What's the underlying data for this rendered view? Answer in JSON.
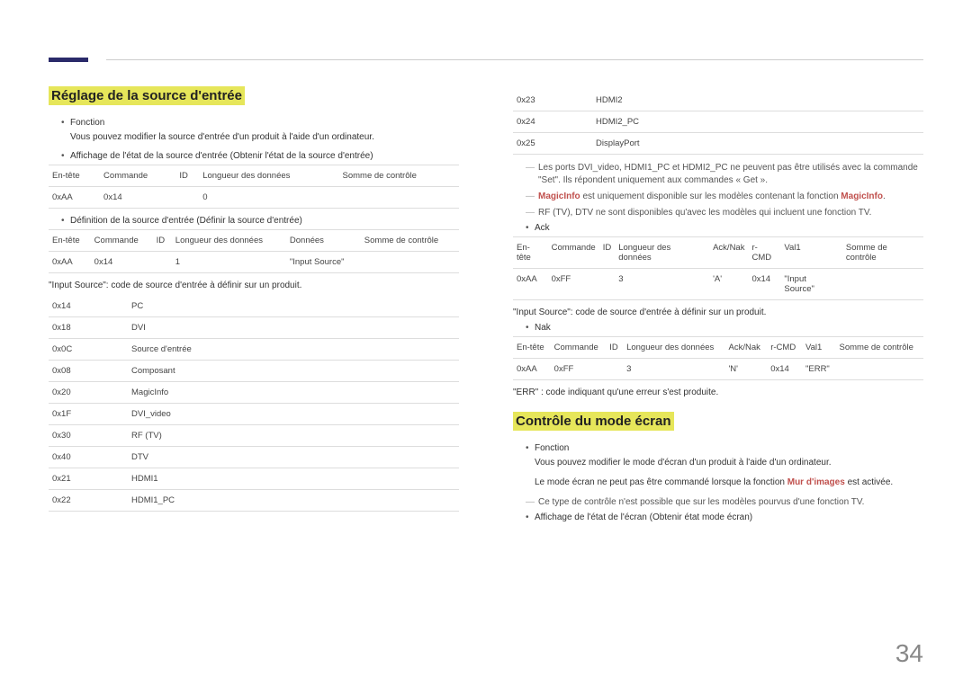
{
  "left": {
    "heading": "Réglage de la source d'entrée",
    "fn_label": "Fonction",
    "fn_text": "Vous pouvez modifier la source d'entrée d'un produit à l'aide d'un ordinateur.",
    "view_label": "Affichage de l'état de la source d'entrée (Obtenir l'état de la source d'entrée)",
    "t1": {
      "h0": "En-tête",
      "h1": "Commande",
      "h2": "ID",
      "h3": "Longueur des données",
      "h4": "Somme de contrôle",
      "r0": "0xAA",
      "r1": "0x14",
      "r2": "",
      "r3": "0",
      "r4": ""
    },
    "set_label": "Définition de la source d'entrée (Définir la source d'entrée)",
    "t2": {
      "h0": "En-tête",
      "h1": "Commande",
      "h2": "ID",
      "h3": "Longueur des données",
      "h4": "Données",
      "h5": "Somme de contrôle",
      "r0": "0xAA",
      "r1": "0x14",
      "r2": "",
      "r3": "1",
      "r4": "\"Input Source\"",
      "r5": ""
    },
    "is_desc": "\"Input Source\": code de source d'entrée à définir sur un produit.",
    "codes": [
      {
        "c": "0x14",
        "l": "PC"
      },
      {
        "c": "0x18",
        "l": "DVI"
      },
      {
        "c": "0x0C",
        "l": "Source d'entrée"
      },
      {
        "c": "0x08",
        "l": "Composant"
      },
      {
        "c": "0x20",
        "l": "MagicInfo"
      },
      {
        "c": "0x1F",
        "l": "DVI_video"
      },
      {
        "c": "0x30",
        "l": "RF (TV)"
      },
      {
        "c": "0x40",
        "l": "DTV"
      },
      {
        "c": "0x21",
        "l": "HDMI1"
      },
      {
        "c": "0x22",
        "l": "HDMI1_PC"
      }
    ]
  },
  "right": {
    "codes_cont": [
      {
        "c": "0x23",
        "l": "HDMI2"
      },
      {
        "c": "0x24",
        "l": "HDMI2_PC"
      },
      {
        "c": "0x25",
        "l": "DisplayPort"
      }
    ],
    "note1": "Les ports DVI_video, HDMI1_PC et HDMI2_PC ne peuvent pas être utilisés avec la commande \"Set\". Ils répondent uniquement aux commandes « Get ».",
    "note2a": "MagicInfo",
    "note2b": " est uniquement disponible sur les modèles contenant la fonction ",
    "note2c": "MagicInfo",
    "note2d": ".",
    "note3": "RF (TV), DTV ne sont disponibles qu'avec les modèles qui incluent une fonction TV.",
    "ack_label": "Ack",
    "ack": {
      "h0": "En-tête",
      "h1": "Commande",
      "h2": "ID",
      "h3": "Longueur des données",
      "h4": "Ack/Nak",
      "h5": "r-CMD",
      "h6": "Val1",
      "h7": "Somme de contrôle",
      "r0": "0xAA",
      "r1": "0xFF",
      "r2": "",
      "r3": "3",
      "r4": "'A'",
      "r5": "0x14",
      "r6": "\"Input Source\"",
      "r7": ""
    },
    "is_desc2": "\"Input Source\": code de source d'entrée à définir sur un produit.",
    "nak_label": "Nak",
    "nak": {
      "h0": "En-tête",
      "h1": "Commande",
      "h2": "ID",
      "h3": "Longueur des données",
      "h4": "Ack/Nak",
      "h5": "r-CMD",
      "h6": "Val1",
      "h7": "Somme de contrôle",
      "r0": "0xAA",
      "r1": "0xFF",
      "r2": "",
      "r3": "3",
      "r4": "'N'",
      "r5": "0x14",
      "r6": "\"ERR\"",
      "r7": ""
    },
    "err_desc": "\"ERR\" : code indiquant qu'une erreur s'est produite.",
    "heading2": "Contrôle du mode écran",
    "fn2_label": "Fonction",
    "fn2_text1": "Vous pouvez modifier le mode d'écran d'un produit à l'aide d'un ordinateur.",
    "fn2_text2a": "Le mode écran ne peut pas être commandé lorsque la fonction ",
    "fn2_text2b": "Mur d'images",
    "fn2_text2c": " est activée.",
    "note4": "Ce type de contrôle n'est possible que sur les modèles pourvus d'une fonction TV.",
    "view2_label": "Affichage de l'état de l'écran (Obtenir état mode écran)"
  },
  "pagenum": "34"
}
